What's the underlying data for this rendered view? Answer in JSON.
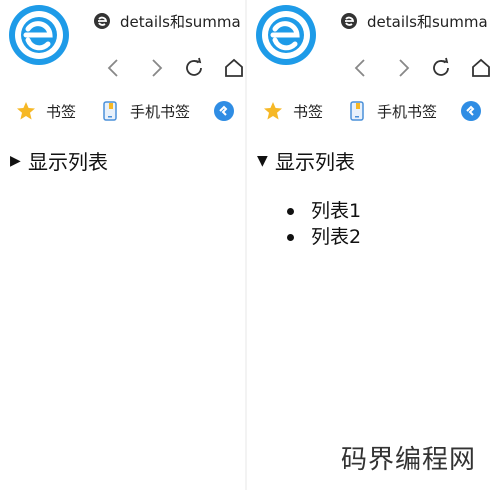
{
  "tab": {
    "title": "details和summa"
  },
  "bookmarks": [
    {
      "label": "书签",
      "icon": "star-icon"
    },
    {
      "label": "手机书签",
      "icon": "mobile-bookmark-icon"
    },
    {
      "label": "",
      "icon": "browser-app-icon"
    }
  ],
  "nav_icons": [
    "back-arrow-icon",
    "forward-arrow-icon",
    "refresh-icon",
    "home-icon"
  ],
  "left_panel": {
    "details": {
      "open": false,
      "marker": "▶",
      "summary": "显示列表"
    }
  },
  "right_panel": {
    "details": {
      "open": true,
      "marker": "▼",
      "summary": "显示列表",
      "items": [
        "列表1",
        "列表2"
      ]
    }
  },
  "watermark": "码界编程网",
  "colors": {
    "logo_blue": "#1e9be8",
    "star_yellow": "#f6b826",
    "mobile_icon_blue": "#4a90d9",
    "text": "#111111"
  }
}
